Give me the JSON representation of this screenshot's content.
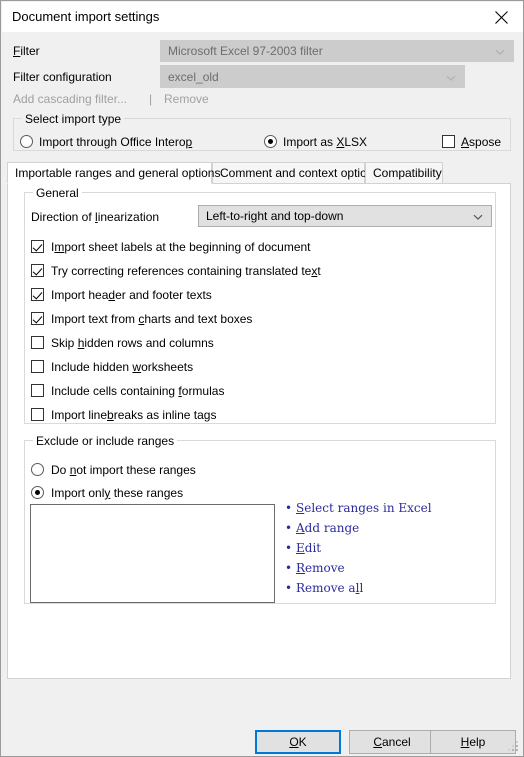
{
  "window": {
    "title": "Document import settings",
    "close_icon": "close-icon"
  },
  "filter_section": {
    "filter_label": "Filter",
    "filter_value": "Microsoft Excel 97-2003 filter",
    "filter_config_label": "Filter configuration",
    "filter_config_value": "excel_old",
    "add_cascading_filter_label": "Add cascading filter...",
    "separator": "|",
    "remove_label": "Remove"
  },
  "import_type": {
    "group_title": "Select import type",
    "office_interop_label": "Import through Office Interop",
    "office_interop_checked": false,
    "xlsx_label": "Import as XLSX",
    "xlsx_checked": true,
    "aspose_label": "Aspose",
    "aspose_checked": false
  },
  "tabs": [
    {
      "label": "Importable ranges and general options",
      "selected": true
    },
    {
      "label": "Comment and context options",
      "selected": false
    },
    {
      "label": "Compatibility",
      "selected": false
    }
  ],
  "general": {
    "group_title": "General",
    "direction_label": "Direction of linearization",
    "direction_value": "Left-to-right and top-down",
    "checkboxes": [
      {
        "label": "Import sheet labels at the beginning of document",
        "checked": true
      },
      {
        "label": "Try correcting references containing translated text",
        "checked": true
      },
      {
        "label": "Import header and footer texts",
        "checked": true
      },
      {
        "label": "Import text from charts and text boxes",
        "checked": true
      },
      {
        "label": "Skip hidden rows and columns",
        "checked": false
      },
      {
        "label": "Include hidden worksheets",
        "checked": false
      },
      {
        "label": "Include cells containing formulas",
        "checked": false
      },
      {
        "label": "Import linebreaks as inline tags",
        "checked": false
      }
    ]
  },
  "ranges": {
    "group_title": "Exclude or include ranges",
    "do_not_import_label": "Do not import these ranges",
    "do_not_import_checked": false,
    "import_only_label": "Import only these ranges",
    "import_only_checked": true,
    "list_items": [],
    "links": [
      "Select ranges in Excel",
      "Add range",
      "Edit",
      "Remove",
      "Remove all"
    ]
  },
  "footer": {
    "ok_label": "OK",
    "cancel_label": "Cancel",
    "help_label": "Help"
  },
  "colors": {
    "accent": "#0078d7",
    "link": "#2b2b9e",
    "dialog_bg": "#f0f0f0",
    "panel_bg": "#ffffff",
    "disabled_text": "#a0a0a0"
  }
}
